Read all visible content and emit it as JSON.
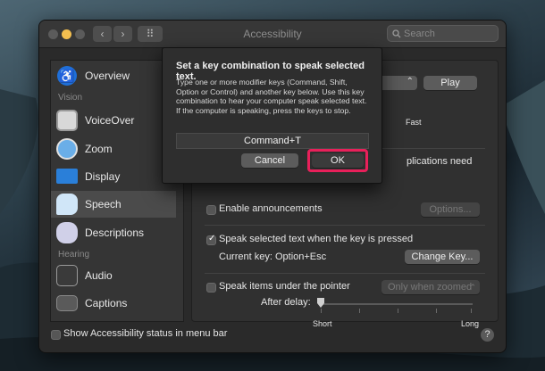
{
  "window": {
    "title": "Accessibility",
    "search_placeholder": "Search",
    "back_arrow": "‹",
    "forward_arrow": "›",
    "grid_glyph": "⠿"
  },
  "sidebar": {
    "items": [
      {
        "label": "Overview",
        "icon": "overview-icon"
      },
      {
        "label": "VoiceOver",
        "icon": "voiceover-icon"
      },
      {
        "label": "Zoom",
        "icon": "zoom-icon"
      },
      {
        "label": "Display",
        "icon": "display-icon"
      },
      {
        "label": "Speech",
        "icon": "speech-icon",
        "selected": true
      },
      {
        "label": "Descriptions",
        "icon": "descriptions-icon"
      },
      {
        "label": "Audio",
        "icon": "audio-icon"
      },
      {
        "label": "Captions",
        "icon": "captions-icon"
      }
    ],
    "headers": {
      "vision": "Vision",
      "hearing": "Hearing"
    }
  },
  "main": {
    "play_button": "Play",
    "rate_fast": "Fast",
    "announcement_partial": "plications need",
    "enable_announcements": "Enable announcements",
    "options_button": "Options...",
    "speak_selected_text": "Speak selected text when the key is pressed",
    "current_key": "Current key: Option+Esc",
    "change_key_button": "Change Key...",
    "speak_items_under_pointer": "Speak items under the pointer",
    "only_when_zoomed": "Only when zoomed",
    "after_delay": "After delay:",
    "delay_short": "Short",
    "delay_long": "Long"
  },
  "footer": {
    "show_status_label": "Show Accessibility status in menu bar",
    "help_label": "?"
  },
  "dialog": {
    "title": "Set a key combination to speak selected text.",
    "body": "Type one or more modifier keys (Command, Shift, Option or Control) and another key below. Use this key combination to hear your computer speak selected text. If the computer is speaking, press the keys to stop.",
    "key_value": "Command+T",
    "cancel_button": "Cancel",
    "ok_button": "OK"
  },
  "colors": {
    "highlight": "#e8205a",
    "accent": "#2e6bd6",
    "sidebar_selected": "#4b4b4b"
  }
}
